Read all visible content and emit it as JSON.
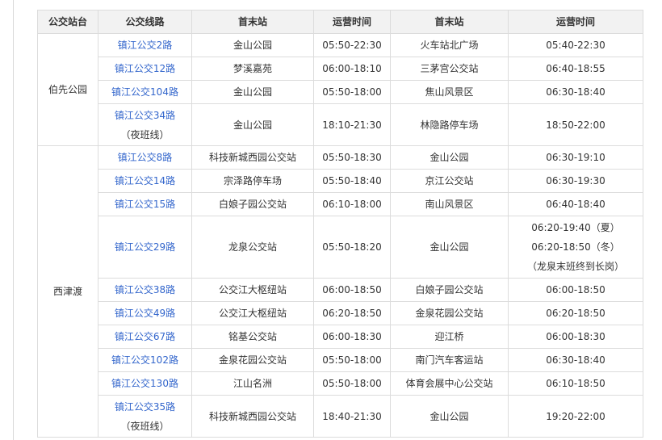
{
  "headers": [
    "公交站台",
    "公交线路",
    "首末站",
    "运营时间",
    "首末站",
    "运营时间"
  ],
  "groups": [
    {
      "station": "伯先公园",
      "rows": [
        {
          "route": "镇江公交2路",
          "note": "",
          "start": "金山公园",
          "time1": [
            "05:50-22:30"
          ],
          "end": "火车站北广场",
          "time2": [
            "05:40-22:30"
          ]
        },
        {
          "route": "镇江公交12路",
          "note": "",
          "start": "梦溪嘉苑",
          "time1": [
            "06:00-18:10"
          ],
          "end": "三茅宫公交站",
          "time2": [
            "06:40-18:55"
          ]
        },
        {
          "route": "镇江公交104路",
          "note": "",
          "start": "金山公园",
          "time1": [
            "05:50-18:00"
          ],
          "end": "焦山风景区",
          "time2": [
            "06:30-18:40"
          ]
        },
        {
          "route": "镇江公交34路",
          "note": "（夜班线）",
          "start": "金山公园",
          "time1": [
            "18:10-21:30"
          ],
          "end": "林隐路停车场",
          "time2": [
            "18:50-22:00"
          ]
        }
      ]
    },
    {
      "station": "西津渡",
      "rows": [
        {
          "route": "镇江公交8路",
          "note": "",
          "start": "科技新城西园公交站",
          "time1": [
            "05:50-18:30"
          ],
          "end": "金山公园",
          "time2": [
            "06:30-19:10"
          ]
        },
        {
          "route": "镇江公交14路",
          "note": "",
          "start": "宗泽路停车场",
          "time1": [
            "05:50-18:40"
          ],
          "end": "京江公交站",
          "time2": [
            "06:30-19:30"
          ]
        },
        {
          "route": "镇江公交15路",
          "note": "",
          "start": "白娘子园公交站",
          "time1": [
            "06:10-18:00"
          ],
          "end": "南山风景区",
          "time2": [
            "06:40-18:40"
          ]
        },
        {
          "route": "镇江公交29路",
          "note": "",
          "start": "龙泉公交站",
          "time1": [
            "05:50-18:20"
          ],
          "end": "金山公园",
          "time2": [
            "06:20-19:40（夏）",
            "06:20-18:50（冬）",
            "（龙泉末班终到长岗）"
          ]
        },
        {
          "route": "镇江公交38路",
          "note": "",
          "start": "公交江大枢纽站",
          "time1": [
            "06:00-18:50"
          ],
          "end": "白娘子园公交站",
          "time2": [
            "06:00-18:50"
          ]
        },
        {
          "route": "镇江公交49路",
          "note": "",
          "start": "公交江大枢纽站",
          "time1": [
            "06:20-18:50"
          ],
          "end": "金泉花园公交站",
          "time2": [
            "06:20-18:50"
          ]
        },
        {
          "route": "镇江公交67路",
          "note": "",
          "start": "铭基公交站",
          "time1": [
            "06:00-18:30"
          ],
          "end": "迎江桥",
          "time2": [
            "06:00-18:30"
          ]
        },
        {
          "route": "镇江公交102路",
          "note": "",
          "start": "金泉花园公交站",
          "time1": [
            "05:50-18:00"
          ],
          "end": "南门汽车客运站",
          "time2": [
            "06:30-18:40"
          ]
        },
        {
          "route": "镇江公交130路",
          "note": "",
          "start": "江山名洲",
          "time1": [
            "05:50-18:00"
          ],
          "end": "体育会展中心公交站",
          "time2": [
            "06:10-18:50"
          ]
        },
        {
          "route": "镇江公交35路",
          "note": "（夜班线）",
          "start": "科技新城西园公交站",
          "time1": [
            "18:40-21:30"
          ],
          "end": "金山公园",
          "time2": [
            "19:20-22:00"
          ]
        }
      ]
    }
  ]
}
